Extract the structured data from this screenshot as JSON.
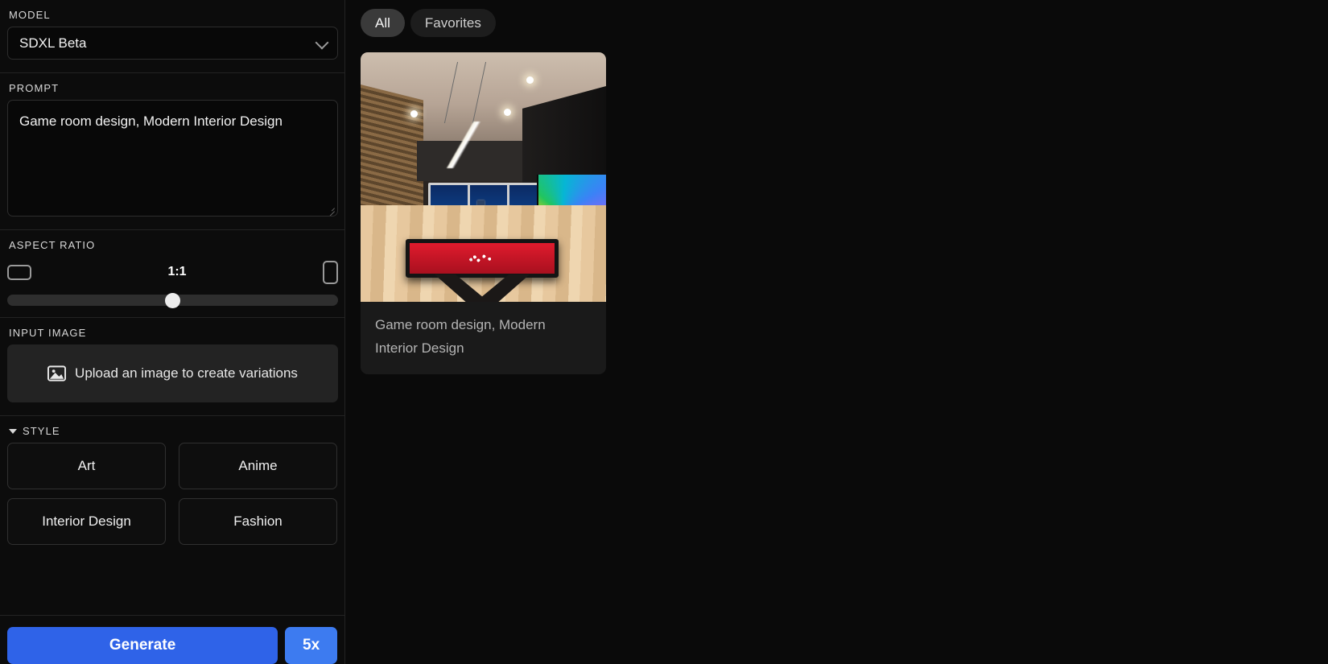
{
  "sidebar": {
    "model": {
      "label": "MODEL",
      "value": "SDXL Beta",
      "chevron_icon": "chevron-down-icon"
    },
    "prompt": {
      "label": "PROMPT",
      "value": "Game room design, Modern Interior Design",
      "resize_icon": "resize-grip-icon"
    },
    "aspect_ratio": {
      "label": "ASPECT RATIO",
      "value": "1:1",
      "landscape_icon": "landscape-frame-icon",
      "portrait_icon": "portrait-frame-icon",
      "slider_position_percent": 50
    },
    "input_image": {
      "label": "INPUT IMAGE",
      "upload_text": "Upload an image to create variations",
      "upload_icon": "image-placeholder-icon"
    },
    "style": {
      "label": "STYLE",
      "caret_icon": "caret-down-icon",
      "options": [
        "Art",
        "Anime",
        "Interior Design",
        "Fashion"
      ]
    },
    "footer": {
      "generate_label": "Generate",
      "multiplier_label": "5x",
      "generate_color": "#2f63e8",
      "multiplier_color": "#3d7bf0"
    }
  },
  "main": {
    "tabs": [
      {
        "label": "All",
        "active": true
      },
      {
        "label": "Favorites",
        "active": false
      }
    ],
    "results": [
      {
        "caption": "Game room design, Modern Interior Design",
        "image_alt": "Modern game room with red pool table, city skyline windows, wood slat wall and large TV"
      }
    ]
  }
}
